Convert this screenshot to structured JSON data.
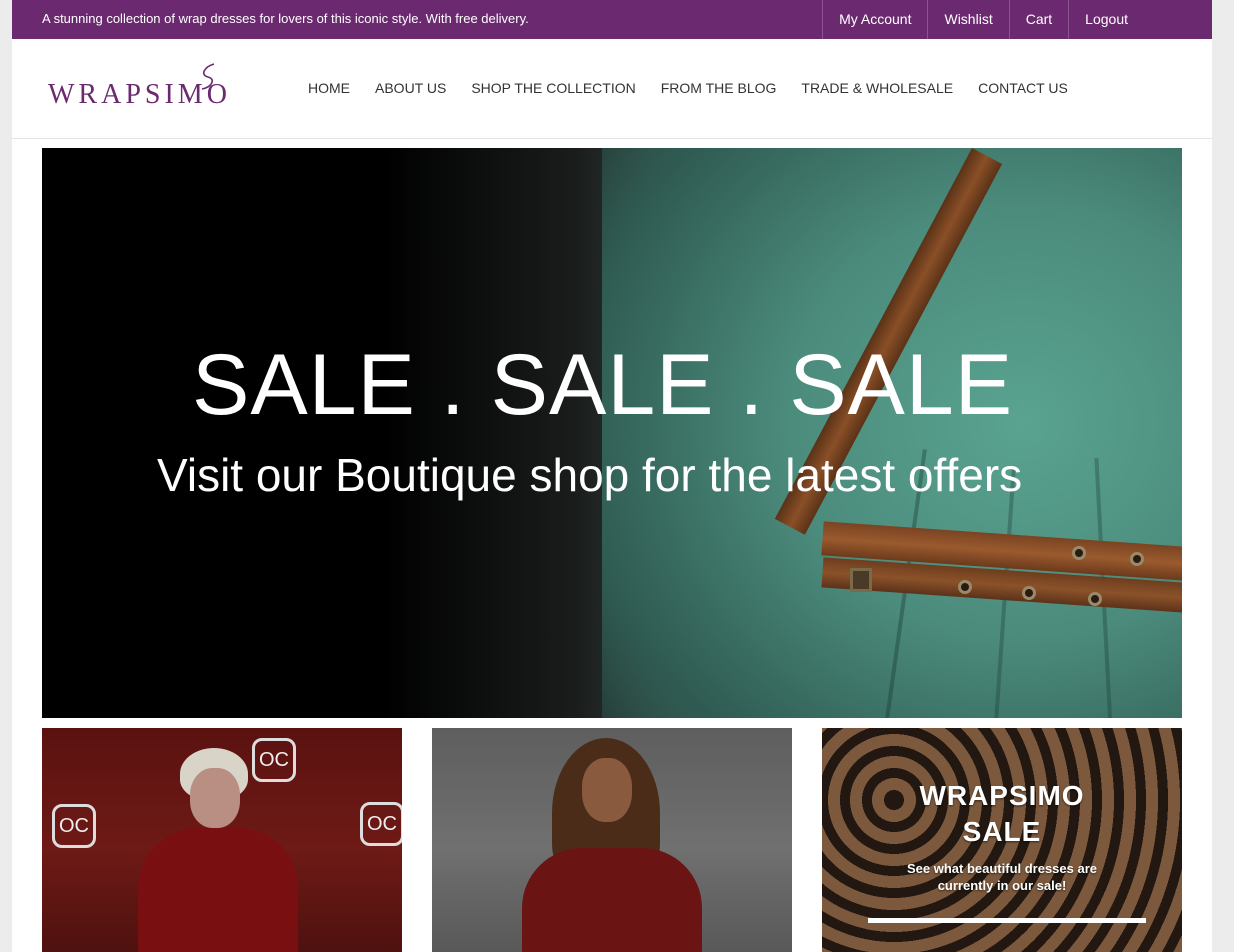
{
  "topbar": {
    "tagline": "A stunning collection of wrap dresses for lovers of this iconic style. With free delivery.",
    "links": [
      "My Account",
      "Wishlist",
      "Cart",
      "Logout"
    ]
  },
  "brand": {
    "logo_text": "WRAPSIMO",
    "accent_color": "#6b2a6f"
  },
  "nav": {
    "items": [
      "HOME",
      "ABOUT US",
      "SHOP THE COLLECTION",
      "FROM THE BLOG",
      "TRADE & WHOLESALE",
      "CONTACT US"
    ]
  },
  "hero": {
    "title": "SALE . SALE . SALE",
    "subtitle": "Visit our Boutique shop for the latest offers"
  },
  "tiles": {
    "sale_tile": {
      "heading_1": "WRAPSIMO",
      "heading_2": "SALE",
      "text_1": "See what beautiful dresses are",
      "text_2": "currently in our sale!"
    }
  }
}
